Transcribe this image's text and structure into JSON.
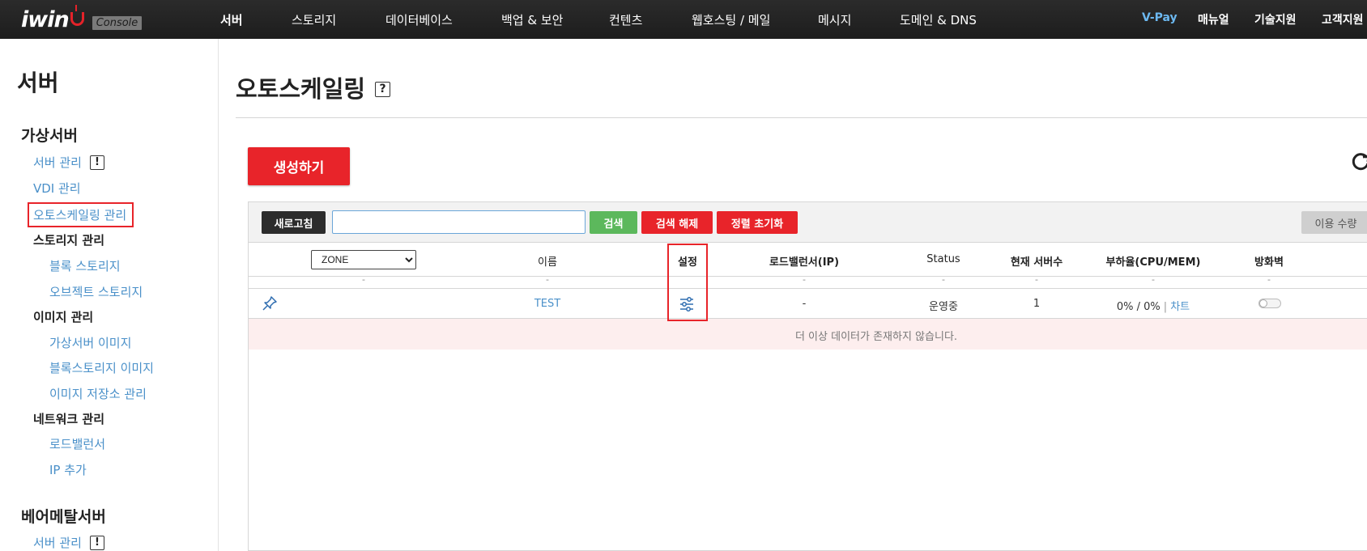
{
  "header": {
    "logo": "iwin",
    "console_badge": "Console",
    "nav": [
      {
        "label": "서버",
        "active": true
      },
      {
        "label": "스토리지"
      },
      {
        "label": "데이터베이스"
      },
      {
        "label": "백업 & 보안"
      },
      {
        "label": "컨텐츠"
      },
      {
        "label": "웹호스팅 / 메일"
      },
      {
        "label": "메시지"
      },
      {
        "label": "도메인 & DNS"
      }
    ],
    "util": [
      "V-Pay",
      "매뉴얼",
      "기술지원",
      "고객지원"
    ]
  },
  "sidebar": {
    "title": "서버",
    "group1": "가상서버",
    "server_manage": "서버 관리",
    "excl": "!",
    "vdi_manage": "VDI 관리",
    "autoscaling_manage": "오토스케일링 관리",
    "storage_manage": "스토리지 관리",
    "block_storage": "블록 스토리지",
    "object_storage": "오브젝트 스토리지",
    "image_manage": "이미지 관리",
    "vm_image": "가상서버 이미지",
    "block_storage_image": "블록스토리지 이미지",
    "image_repo": "이미지 저장소 관리",
    "network_manage": "네트워크 관리",
    "load_balancer": "로드밸런서",
    "ip_add": "IP 추가",
    "group2": "베어메탈서버",
    "bm_server_manage": "서버 관리"
  },
  "main": {
    "title": "오토스케일링",
    "help": "?",
    "create_button": "생성하기",
    "toolbar": {
      "refresh": "새로고침",
      "search_value": "",
      "search": "검색",
      "search_clear": "검색 해제",
      "sort_reset": "정렬 초기화",
      "usage": "이용 수량"
    },
    "table": {
      "zone_select": "ZONE",
      "columns": [
        "이름",
        "설정",
        "로드밸런서(IP)",
        "Status",
        "현재 서버수",
        "부하율(CPU/MEM)",
        "방화벽"
      ],
      "filter_dash": "-",
      "row": {
        "name": "TEST",
        "load_balancer": "-",
        "status": "운영중",
        "server_count": "1",
        "load_rate": "0% / 0%",
        "separator": "|",
        "chart_link": "차트"
      },
      "empty_message": "더 이상 데이터가 존재하지 않습니다."
    }
  },
  "colors": {
    "brand_red": "#e8242a",
    "link_blue": "#4a90c9",
    "green": "#5cb85c"
  }
}
